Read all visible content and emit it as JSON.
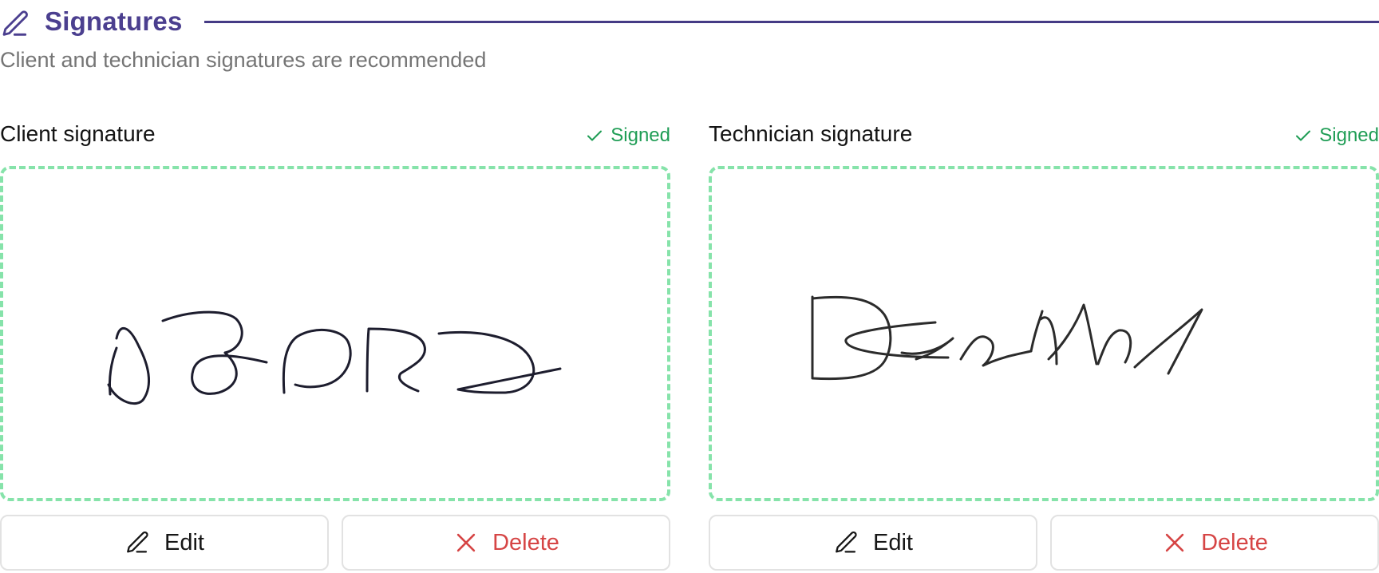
{
  "section": {
    "title": "Signatures",
    "subtitle": "Client and technician signatures are recommended",
    "icon": "pencil-icon",
    "accent_color": "#4b3f8f"
  },
  "client": {
    "label": "Client signature",
    "status": "Signed",
    "status_icon": "check-icon",
    "status_color": "#1f9d55",
    "edit_label": "Edit",
    "delete_label": "Delete"
  },
  "technician": {
    "label": "Technician signature",
    "status": "Signed",
    "status_icon": "check-icon",
    "status_color": "#1f9d55",
    "edit_label": "Edit",
    "delete_label": "Delete"
  },
  "colors": {
    "pad_border": "#86e3aa",
    "delete_text": "#d64545"
  }
}
